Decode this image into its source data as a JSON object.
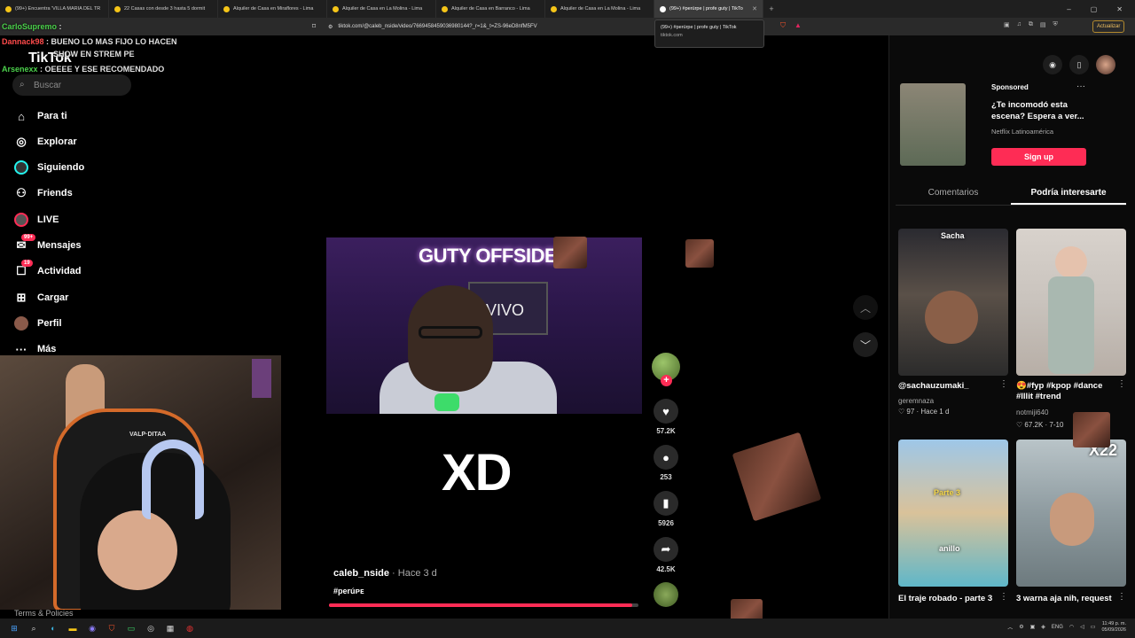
{
  "browser": {
    "tabs": [
      {
        "label": "(99+) Encuentra 'VILLA MARIA DEL TR",
        "active": false
      },
      {
        "label": "22 Casas con desde 3 hasta 5 dormit",
        "active": false
      },
      {
        "label": "Alquiler de Casa en Miraflores - Lima",
        "active": false
      },
      {
        "label": "Alquiler de Casa en La Molina - Lima",
        "active": false
      },
      {
        "label": "Alquiler de Casa en Barranco - Lima",
        "active": false
      },
      {
        "label": "Alquiler de Casa en La Molina - Lima",
        "active": false
      },
      {
        "label": "(99+) #perúrpe | profe guty | TikTo",
        "active": true
      }
    ],
    "url": "tiktok.com/@caleb_nside/video/7669458459036980144?_r=1&_t=ZS-96eD8nfM5FV",
    "update_label": "Actualizar",
    "tooltip": {
      "title": "(99+) #perúrpe | profe guty | TikTok",
      "domain": "tiktok.com"
    }
  },
  "chat": [
    {
      "user": "CarloSupremo",
      "message": "",
      "color": "#4bd04b"
    },
    {
      "user": "Dannack98",
      "message": "BUENO LO MAS FIJO LO HACEN",
      "color": "#ff4b4b"
    },
    {
      "user": "",
      "message": "SHOW EN STREM PE",
      "color": "#e0e0e0"
    },
    {
      "user": "Arsenexx",
      "message": "OEEEE Y ESE RECOMENDADO",
      "color": "#4bd04b"
    }
  ],
  "sidebar": {
    "brand": "TikTok",
    "search_placeholder": "Buscar",
    "items": [
      {
        "label": "Para ti",
        "icon": "home-icon",
        "badge": ""
      },
      {
        "label": "Explorar",
        "icon": "compass-icon",
        "badge": ""
      },
      {
        "label": "Siguiendo",
        "icon": "following-icon",
        "badge": ""
      },
      {
        "label": "Friends",
        "icon": "friends-icon",
        "badge": ""
      },
      {
        "label": "LIVE",
        "icon": "live-icon",
        "badge": ""
      },
      {
        "label": "Mensajes",
        "icon": "messages-icon",
        "badge": "99+"
      },
      {
        "label": "Actividad",
        "icon": "activity-icon",
        "badge": "19"
      },
      {
        "label": "Cargar",
        "icon": "upload-icon",
        "badge": ""
      },
      {
        "label": "Perfil",
        "icon": "profile-icon",
        "badge": ""
      },
      {
        "label": "Más",
        "icon": "more-icon",
        "badge": ""
      }
    ],
    "terms": "Terms & Policies"
  },
  "video": {
    "clip_title": "GUTY OFFSIDE",
    "clip_vivo": "VIVO",
    "caption_overlay": "XD",
    "author": "caleb_nside",
    "posted": "· Hace 3 d",
    "hashtag": "#perúᴘᴇ",
    "progress_fraction": 0.98,
    "actions": {
      "likes": "57.2K",
      "comments": "253",
      "saves": "5926",
      "shares": "42.5K"
    }
  },
  "right_panel": {
    "ad": {
      "sponsored": "Sponsored",
      "title": "¿Te incomodó esta escena? Espera a ver...",
      "advertiser": "Netflix Latinoamérica",
      "cta": "Sign up"
    },
    "tabs": [
      {
        "label": "Comentarios",
        "active": false
      },
      {
        "label": "Podría interesarte",
        "active": true
      }
    ],
    "videos": [
      {
        "title": "@sachauzumaki_",
        "user": "geremnaza",
        "stats": "♡ 97 · Hace 1 d",
        "overlay": "Sacha"
      },
      {
        "title": "😍#fyp #kpop #dance #lllit #trend",
        "user": "notmiji640",
        "stats": "♡ 67.2K · 7-10",
        "overlay": ""
      },
      {
        "title": "El traje robado - parte 3",
        "user": "",
        "stats": "",
        "overlay": "Parte 3"
      },
      {
        "title": "3 warna aja nih, request",
        "user": "",
        "stats": "",
        "overlay": "X22"
      }
    ],
    "anillo_label": "anillo"
  },
  "taskbar": {
    "lang": "ENG",
    "time": "11:49 p. m.",
    "date": "05/09/2026"
  }
}
